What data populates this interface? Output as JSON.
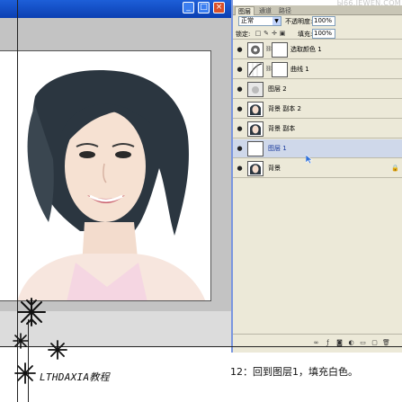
{
  "watermark": "Ы66.JEWEN.COM",
  "document": {
    "min_label": "_",
    "close_label": "×"
  },
  "panel": {
    "tabs": [
      "图层",
      "通道",
      "路径"
    ],
    "blend_mode": "正常",
    "opacity_label": "不透明度:",
    "opacity_value": "100%",
    "lock_label": "锁定:",
    "fill_label": "填充:",
    "fill_value": "100%"
  },
  "layers": [
    {
      "name": "选取颜色 1",
      "type": "adjustment"
    },
    {
      "name": "曲线 1",
      "type": "adjustment"
    },
    {
      "name": "图层 2",
      "type": "image"
    },
    {
      "name": "背景 副本 2",
      "type": "image"
    },
    {
      "name": "背景 副本",
      "type": "image"
    },
    {
      "name": "图层 1",
      "type": "blank",
      "selected": true
    },
    {
      "name": "背景",
      "type": "image",
      "locked": true
    }
  ],
  "caption": {
    "brand": "LTHDAXIA教程",
    "step": "12：回到图层1，填充白色。"
  },
  "colors": {
    "titlebar": "#1d5fd8",
    "panel_bg": "#ece9d8",
    "selected_row": "#cfd8ea"
  }
}
